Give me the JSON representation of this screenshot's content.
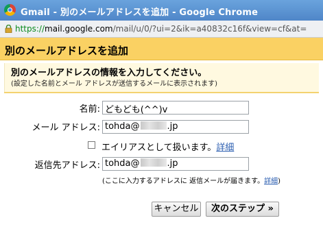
{
  "window": {
    "title": "Gmail - 別のメールアドレスを追加 - Google Chrome"
  },
  "urlbar": {
    "scheme": "https://",
    "domain": "mail.google.com",
    "path": "/mail/u/0/?ui=2&ik=a40832c16f&view=cf&at="
  },
  "dialog": {
    "header_title": "別のメールアドレスを追加",
    "panel_title": "別のメールアドレスの情報を入力してください。",
    "panel_subtitle": "(設定した名前とメール アドレスが送信するメールに表示されます)",
    "name_label": "名前:",
    "name_value": "どもども(^^)v",
    "email_label": "メール アドレス:",
    "email_prefix": "tohda@",
    "email_suffix": ".jp",
    "alias_label": "エイリアスとして扱います。",
    "alias_link": "詳細",
    "alias_checked": false,
    "reply_label": "返信先アドレス:",
    "reply_prefix": "tohda@",
    "reply_suffix": ".jp",
    "reply_note": "(ここに入力するアドレスに 返信メールが届きます。",
    "reply_note_link": "詳細",
    "reply_note_end": ")",
    "cancel_label": "キャンセル",
    "next_label": "次のステップ »"
  }
}
